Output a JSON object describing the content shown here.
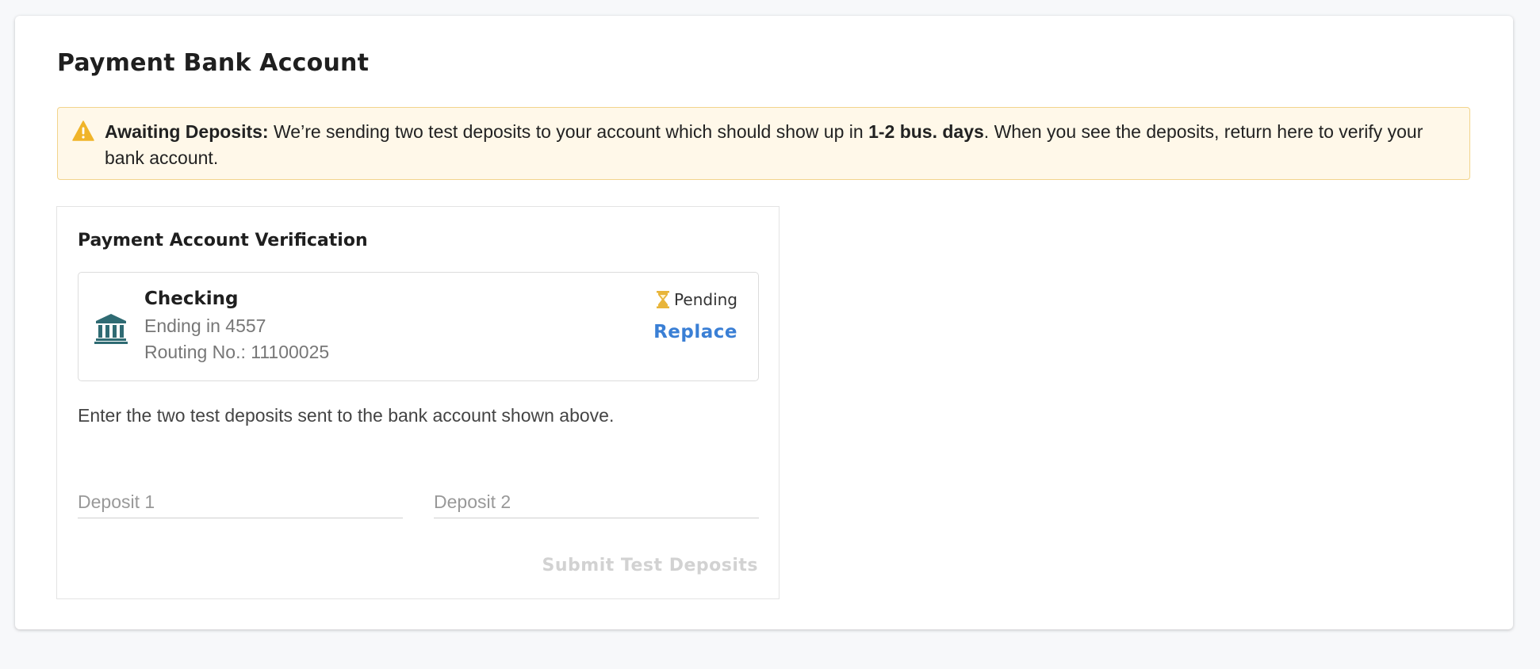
{
  "page": {
    "title": "Payment Bank Account"
  },
  "alert": {
    "icon": "warning-icon",
    "label": "Awaiting Deposits:",
    "text_before": " We’re sending two test deposits to your account which should show up in ",
    "highlight": "1-2 bus. days",
    "text_after": ". When you see the deposits, return here to verify your bank account.",
    "colors": {
      "background": "#fff8e9",
      "border": "#f2d48c",
      "icon": "#f0b429"
    }
  },
  "verification": {
    "title": "Payment Account Verification",
    "account": {
      "icon": "bank-icon",
      "type": "Checking",
      "ending": "Ending in 4557",
      "routing": "Routing No.: 11100025",
      "status_icon": "hourglass-icon",
      "status": "Pending",
      "replace_label": "Replace"
    },
    "instructions": "Enter the two test deposits sent to the bank account shown above.",
    "deposit1": {
      "placeholder": "Deposit 1",
      "value": ""
    },
    "deposit2": {
      "placeholder": "Deposit 2",
      "value": ""
    },
    "submit_label": "Submit Test Deposits"
  },
  "colors": {
    "accent": "#3a7fd5",
    "bank_icon": "#2f6b73",
    "pending_icon": "#e8b53a",
    "disabled_text": "#d2d2d2"
  }
}
